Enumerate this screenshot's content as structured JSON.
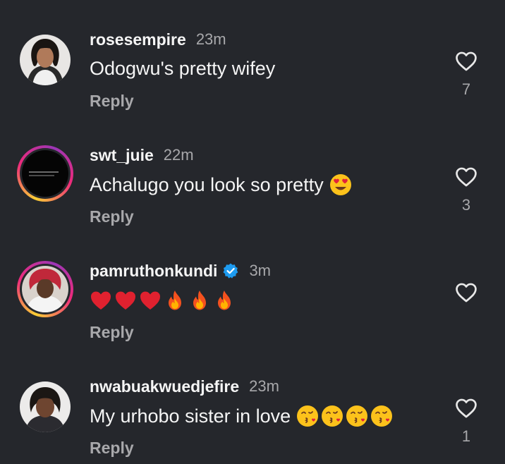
{
  "comments": [
    {
      "username": "rosesempire",
      "time": "23m",
      "text": "Odogwu's pretty wifey",
      "reply_label": "Reply",
      "likes": "7"
    },
    {
      "username": "swt_juie",
      "time": "22m",
      "text": "Achalugo you look so pretty",
      "emoji": [
        "heart-eyes-emoji"
      ],
      "reply_label": "Reply",
      "likes": "3"
    },
    {
      "username": "pamruthonkundi",
      "verified": true,
      "time": "3m",
      "text": "",
      "emoji": [
        "red-heart-emoji",
        "red-heart-emoji",
        "red-heart-emoji",
        "fire-emoji",
        "fire-emoji",
        "fire-emoji"
      ],
      "reply_label": "Reply",
      "likes": ""
    },
    {
      "username": "nwabuakwuedjefire",
      "time": "23m",
      "text": "My urhobo sister in love",
      "emoji": [
        "kissing-heart-emoji",
        "kissing-heart-emoji",
        "kissing-heart-emoji",
        "kissing-heart-emoji"
      ],
      "reply_label": "Reply",
      "likes": "1"
    }
  ],
  "colors": {
    "background": "#25272c",
    "primary_text": "#f5f5f5",
    "secondary_text": "#a8a8ab",
    "verified_badge": "#1d9bf0"
  }
}
